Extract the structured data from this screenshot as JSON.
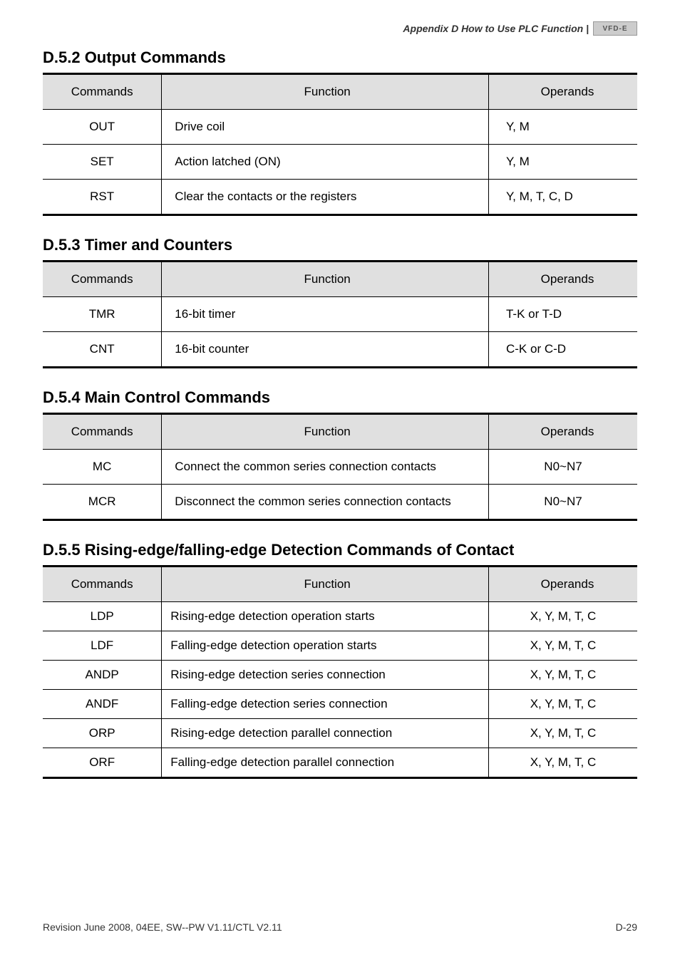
{
  "header": {
    "text": "Appendix D How to Use PLC Function |",
    "logo": "VFD-E"
  },
  "sections": [
    {
      "title": "D.5.2 Output Commands",
      "tableClass": "",
      "opClass": "",
      "headers": {
        "cmd": "Commands",
        "func": "Function",
        "op": "Operands"
      },
      "rows": [
        {
          "cmd": "OUT",
          "func": "Drive coil",
          "op": "Y, M"
        },
        {
          "cmd": "SET",
          "func": "Action latched (ON)",
          "op": "Y, M"
        },
        {
          "cmd": "RST",
          "func": "Clear the contacts or the registers",
          "op": "Y, M, T, C, D"
        }
      ]
    },
    {
      "title": "D.5.3 Timer and Counters",
      "tableClass": "",
      "opClass": "",
      "headers": {
        "cmd": "Commands",
        "func": "Function",
        "op": "Operands"
      },
      "rows": [
        {
          "cmd": "TMR",
          "func": "16-bit timer",
          "op": "T-K or T-D"
        },
        {
          "cmd": "CNT",
          "func": "16-bit counter",
          "op": "C-K or C-D"
        }
      ]
    },
    {
      "title": "D.5.4 Main Control Commands",
      "tableClass": "",
      "opClass": "op-center",
      "headers": {
        "cmd": "Commands",
        "func": "Function",
        "op": "Operands"
      },
      "rows": [
        {
          "cmd": "MC",
          "func": "Connect the common series connection contacts",
          "op": "N0~N7"
        },
        {
          "cmd": "MCR",
          "func": "Disconnect the common series connection contacts",
          "op": "N0~N7"
        }
      ]
    },
    {
      "title": "D.5.5 Rising-edge/falling-edge Detection Commands of Contact",
      "tableClass": "dense",
      "opClass": "op-center",
      "headers": {
        "cmd": "Commands",
        "func": "Function",
        "op": "Operands"
      },
      "rows": [
        {
          "cmd": "LDP",
          "func": "Rising-edge detection operation starts",
          "op": "X, Y, M, T, C"
        },
        {
          "cmd": "LDF",
          "func": "Falling-edge detection operation starts",
          "op": "X, Y, M, T, C"
        },
        {
          "cmd": "ANDP",
          "func": "Rising-edge detection series connection",
          "op": "X, Y, M, T, C"
        },
        {
          "cmd": "ANDF",
          "func": "Falling-edge detection series connection",
          "op": "X, Y, M, T, C"
        },
        {
          "cmd": "ORP",
          "func": "Rising-edge detection parallel connection",
          "op": "X, Y, M, T, C"
        },
        {
          "cmd": "ORF",
          "func": "Falling-edge detection parallel connection",
          "op": "X, Y, M, T, C"
        }
      ]
    }
  ],
  "footer": {
    "left": "Revision June 2008, 04EE, SW--PW V1.11/CTL V2.11",
    "right": "D-29"
  }
}
